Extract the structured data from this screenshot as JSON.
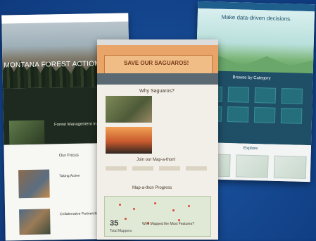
{
  "montana": {
    "title": "MONTANA FOREST ACTION PL",
    "section1": "Forest Management in a Chang",
    "section2": "Our Focus",
    "item1": "Taking Action",
    "item2": "Collaborative Partnerships"
  },
  "data_driven": {
    "heading": "Make data-driven decisions.",
    "category_title": "Browse by Category",
    "explore_title": "Explore"
  },
  "saguaro": {
    "banner_title": "SAVE OUR SAGUAROS!",
    "why_title": "Why Saguaros?",
    "join_title": "Join our Map-a-thon!",
    "progress_title": "Map-a-thon Progress",
    "count_value": "35",
    "count_label": "Total Mappers",
    "leader_title": "Who Mapped the Most Features?"
  }
}
